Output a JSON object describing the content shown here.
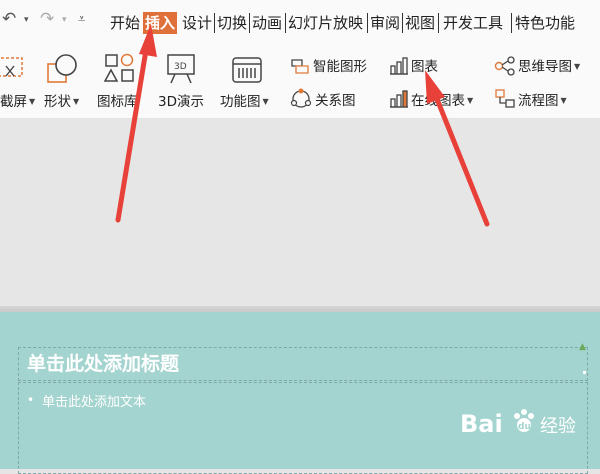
{
  "quick_access": {
    "undo_icon": "undo-icon",
    "redo_icon": "redo-icon",
    "customize_icon": "customize-icon"
  },
  "menu": {
    "tabs": [
      {
        "label": "开始"
      },
      {
        "label": "插入"
      },
      {
        "label": "设计"
      },
      {
        "label": "切换"
      },
      {
        "label": "动画"
      },
      {
        "label": "幻灯片放映"
      },
      {
        "label": "审阅"
      },
      {
        "label": "视图"
      },
      {
        "label": "开发工具"
      },
      {
        "label": "特色功能"
      }
    ],
    "active_tab": "插入",
    "active_color": "#e0703a"
  },
  "ribbon": {
    "screenshot_label": "截屏",
    "shapes_label": "形状",
    "icon_library_label": "图标库",
    "demo3d_label": "3D演示",
    "function_chart_label": "功能图",
    "smartart_label": "智能图形",
    "relation_label": "关系图",
    "chart_label": "图表",
    "online_chart_label": "在线图表",
    "mindmap_label": "思维导图",
    "flowchart_label": "流程图",
    "demo3d_icon_text": "3D"
  },
  "slide": {
    "title_placeholder": "单击此处添加标题",
    "body_placeholder": "单击此处添加文本",
    "bullet": "•",
    "background": "#a3d4cf"
  },
  "watermark": {
    "brand_left": "Bai",
    "brand_right": "经验",
    "brand_middle": "du"
  },
  "annotations": {
    "arrow_color": "#e8413a"
  }
}
